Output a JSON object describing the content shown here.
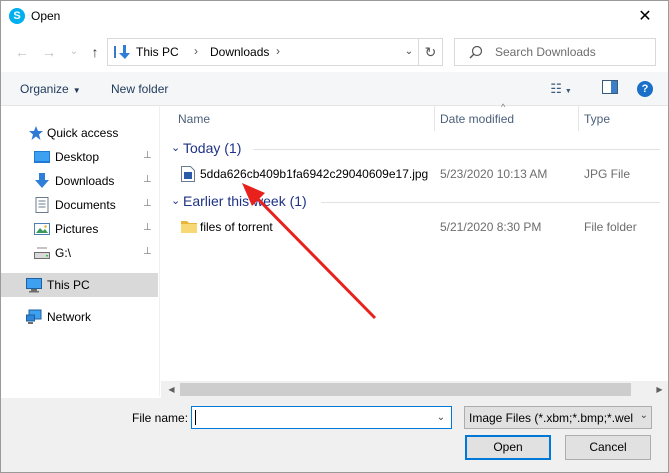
{
  "window": {
    "title": "Open",
    "app_icon_letter": "S",
    "close_glyph": "✕"
  },
  "nav": {
    "back_glyph": "←",
    "forward_glyph": "→",
    "recent_glyph": "⌄",
    "up_glyph": "↑"
  },
  "address": {
    "crumbs": [
      "This PC",
      "Downloads"
    ],
    "separator": "›",
    "dropdown_glyph": "⌄",
    "refresh_glyph": "↻"
  },
  "search": {
    "placeholder": "Search Downloads"
  },
  "toolbar": {
    "organize_label": "Organize",
    "organize_caret": "▼",
    "new_folder_label": "New folder",
    "view_glyph": "☷",
    "view_caret": "▼",
    "help_glyph": "?"
  },
  "sidebar": {
    "items": [
      {
        "label": "Quick access",
        "icon": "star-icon",
        "pinned": false
      },
      {
        "label": "Desktop",
        "icon": "desktop-icon",
        "pinned": true
      },
      {
        "label": "Downloads",
        "icon": "download-icon",
        "pinned": true
      },
      {
        "label": "Documents",
        "icon": "document-icon",
        "pinned": true
      },
      {
        "label": "Pictures",
        "icon": "pictures-icon",
        "pinned": true
      },
      {
        "label": "G:\\",
        "icon": "drive-icon",
        "pinned": true
      },
      {
        "label": "This PC",
        "icon": "computer-icon",
        "pinned": false,
        "selected": true
      },
      {
        "label": "Network",
        "icon": "network-icon",
        "pinned": false
      }
    ],
    "pin_glyph": "📌"
  },
  "columns": {
    "name": "Name",
    "date": "Date modified",
    "type": "Type",
    "sort_glyph": "^"
  },
  "groups": [
    {
      "label": "Today (1)",
      "caret": "⌄",
      "rows": [
        {
          "name": "5dda626cb409b1fa6942c29040609e17.jpg",
          "date": "5/23/2020 10:13 AM",
          "type": "JPG File",
          "icon": "image-file-icon"
        }
      ]
    },
    {
      "label": "Earlier this week (1)",
      "caret": "⌄",
      "rows": [
        {
          "name": "files of torrent",
          "date": "5/21/2020 8:30 PM",
          "type": "File folder",
          "icon": "folder-icon"
        }
      ]
    }
  ],
  "scrollbar": {
    "left_glyph": "◀",
    "right_glyph": "▶"
  },
  "bottom": {
    "file_name_label": "File name:",
    "file_name_value": "",
    "file_name_drop": "⌄",
    "filter_value": "Image Files (*.xbm;*.bmp;*.wel",
    "filter_drop": "⌄",
    "open_label": "Open",
    "cancel_label": "Cancel"
  },
  "colors": {
    "accent": "#0078d7",
    "group_header": "#1e3287",
    "annotation_arrow": "#e8211c"
  }
}
